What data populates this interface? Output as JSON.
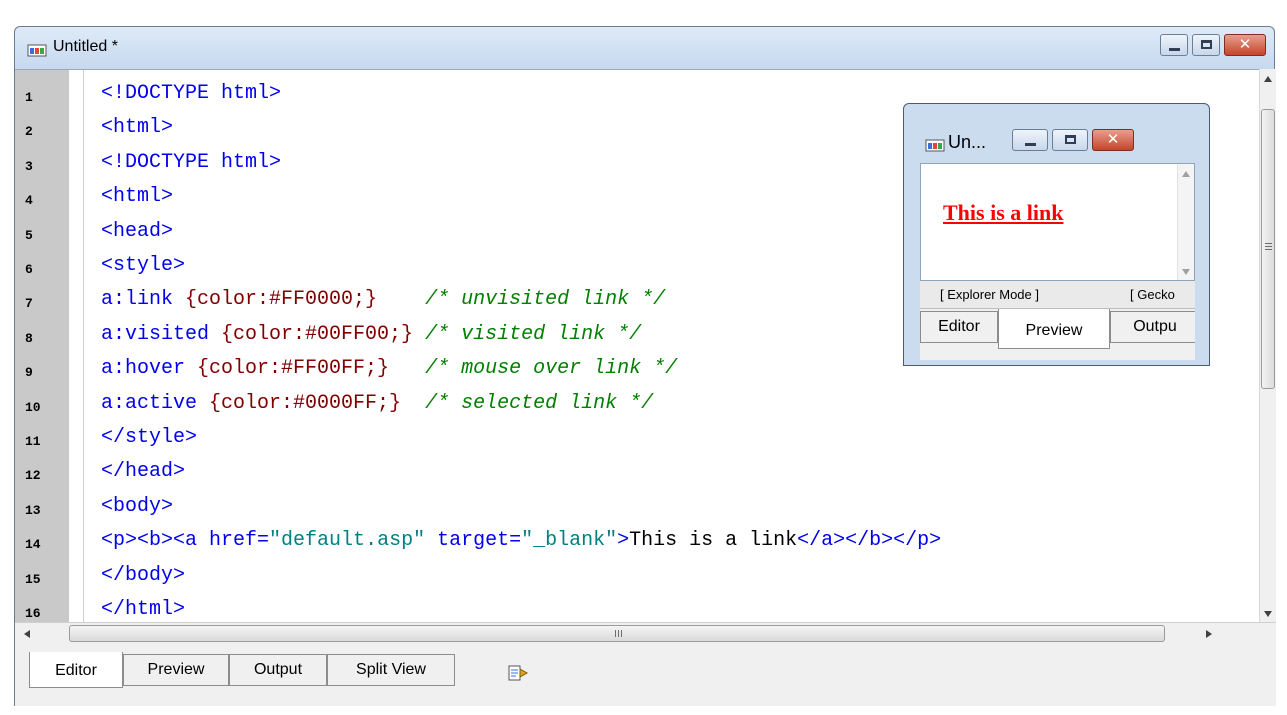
{
  "window": {
    "title": "Untitled *",
    "buttons": {
      "minimize_icon": "minimize-icon",
      "maximize_icon": "maximize-icon",
      "close_label": "✕"
    }
  },
  "editor": {
    "lines": [
      {
        "num": "1",
        "parts": [
          {
            "t": "<!DOCTYPE html>",
            "c": "tag"
          }
        ]
      },
      {
        "num": "2",
        "parts": [
          {
            "t": "<html>",
            "c": "tag"
          }
        ]
      },
      {
        "num": "3",
        "parts": [
          {
            "t": "<!DOCTYPE html>",
            "c": "tag"
          }
        ]
      },
      {
        "num": "4",
        "parts": [
          {
            "t": "<html>",
            "c": "tag"
          }
        ]
      },
      {
        "num": "5",
        "parts": [
          {
            "t": "<head>",
            "c": "tag"
          }
        ]
      },
      {
        "num": "6",
        "parts": [
          {
            "t": "<style>",
            "c": "tag"
          }
        ]
      },
      {
        "num": "7",
        "parts": [
          {
            "t": "a:link ",
            "c": "tag"
          },
          {
            "t": "{color:#FF0000;}",
            "c": "val"
          },
          {
            "t": "    ",
            "c": "txt"
          },
          {
            "t": "/* unvisited link */",
            "c": "cmt"
          }
        ]
      },
      {
        "num": "8",
        "parts": [
          {
            "t": "a:visited ",
            "c": "tag"
          },
          {
            "t": "{color:#00FF00;}",
            "c": "val"
          },
          {
            "t": " ",
            "c": "txt"
          },
          {
            "t": "/* visited link */",
            "c": "cmt"
          }
        ]
      },
      {
        "num": "9",
        "parts": [
          {
            "t": "a:hover ",
            "c": "tag"
          },
          {
            "t": "{color:#FF00FF;}",
            "c": "val"
          },
          {
            "t": "   ",
            "c": "txt"
          },
          {
            "t": "/* mouse over link */",
            "c": "cmt"
          }
        ]
      },
      {
        "num": "10",
        "parts": [
          {
            "t": "a:active ",
            "c": "tag"
          },
          {
            "t": "{color:#0000FF;}",
            "c": "val"
          },
          {
            "t": "  ",
            "c": "txt"
          },
          {
            "t": "/* selected link */",
            "c": "cmt"
          }
        ]
      },
      {
        "num": "11",
        "parts": [
          {
            "t": "</style>",
            "c": "tag"
          }
        ]
      },
      {
        "num": "12",
        "parts": [
          {
            "t": "</head>",
            "c": "tag"
          }
        ]
      },
      {
        "num": "13",
        "parts": [
          {
            "t": "<body>",
            "c": "tag"
          }
        ]
      },
      {
        "num": "14",
        "parts": [
          {
            "t": "<p><b><a ",
            "c": "tag"
          },
          {
            "t": "href=",
            "c": "attr"
          },
          {
            "t": "\"default.asp\"",
            "c": "str"
          },
          {
            "t": " target=",
            "c": "attr"
          },
          {
            "t": "\"_blank\"",
            "c": "str"
          },
          {
            "t": ">",
            "c": "tag"
          },
          {
            "t": "This is a link",
            "c": "txt"
          },
          {
            "t": "</a></b></p>",
            "c": "tag"
          }
        ]
      },
      {
        "num": "15",
        "parts": [
          {
            "t": "</body>",
            "c": "tag"
          }
        ]
      },
      {
        "num": "16",
        "parts": [
          {
            "t": "</html>",
            "c": "tag"
          }
        ]
      }
    ]
  },
  "scrollbars": {
    "hgrip_label": "III",
    "vgrip_label": "≡"
  },
  "tabs": {
    "editor": "Editor",
    "preview": "Preview",
    "output": "Output",
    "split_view": "Split View",
    "extra_icon": "refresh-preview-icon"
  },
  "preview_window": {
    "title": "Un...",
    "link_text": "This is a link",
    "link_color": "#FF0000",
    "modes": {
      "explorer": "[ Explorer Mode ]",
      "gecko": "[ Gecko"
    },
    "tabs": {
      "editor": "Editor",
      "preview": "Preview",
      "output": "Outpu"
    }
  }
}
